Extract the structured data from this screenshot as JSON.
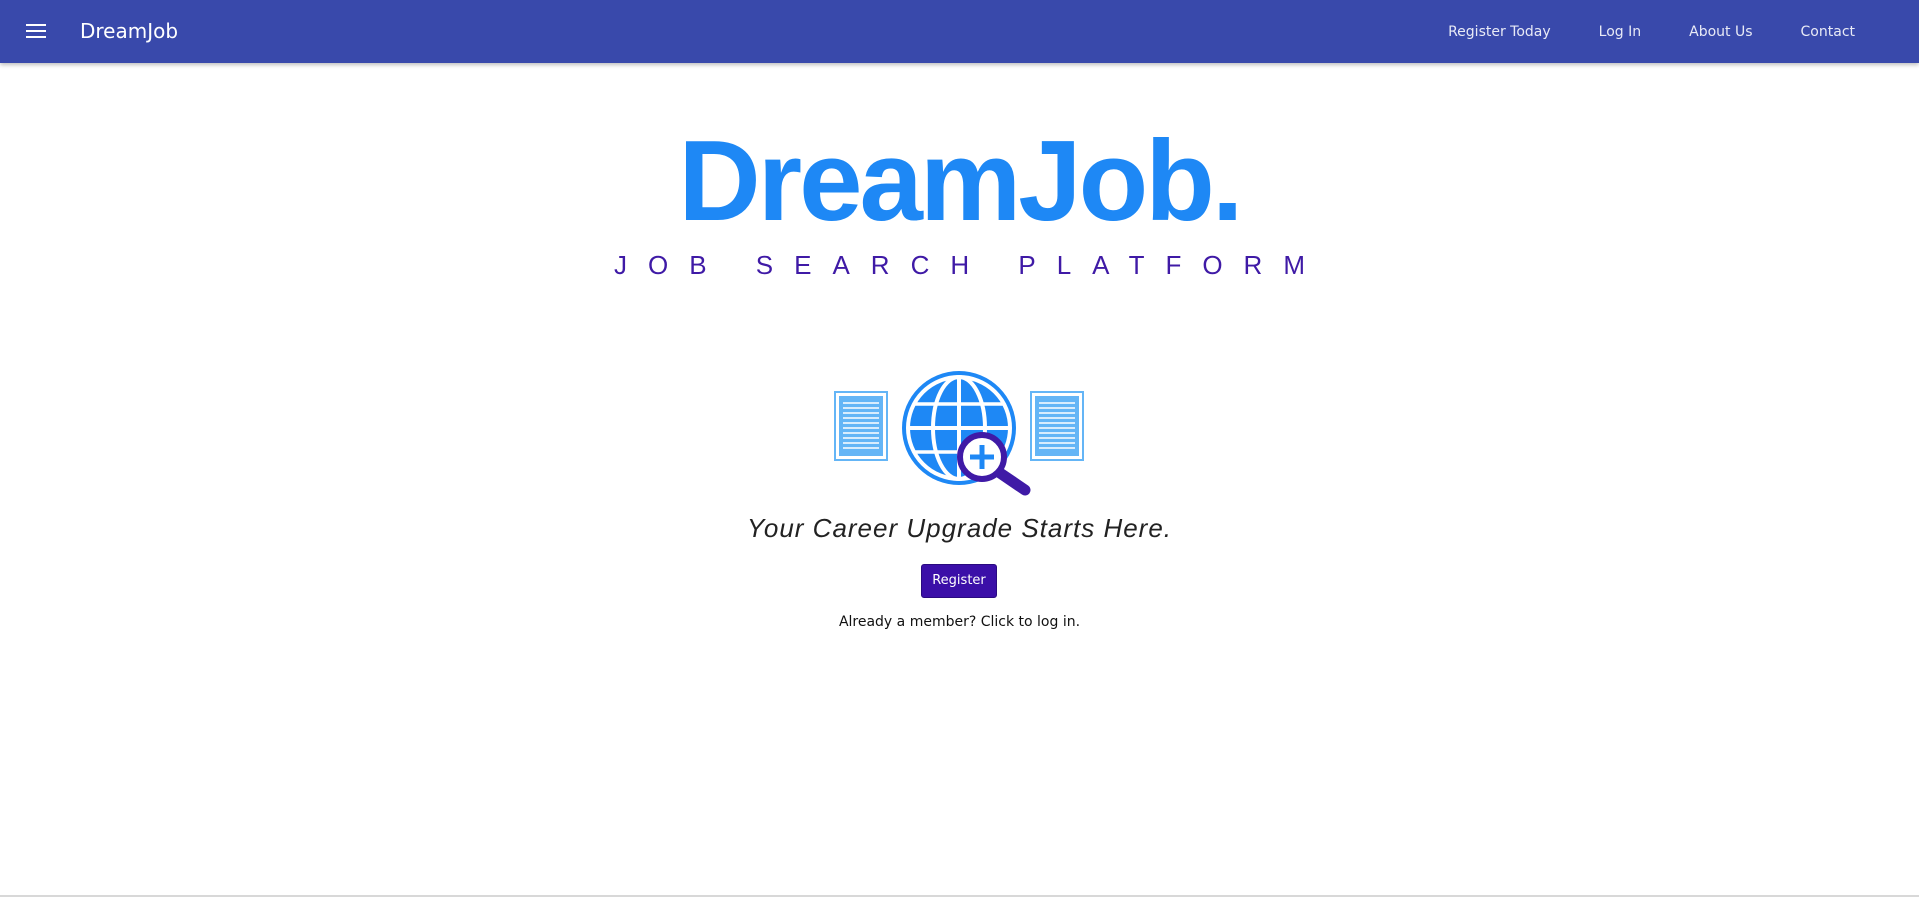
{
  "appbar": {
    "brand": "DreamJob",
    "menu_icon": "hamburger-menu-icon",
    "nav": [
      {
        "label": "Register Today"
      },
      {
        "label": "Log In"
      },
      {
        "label": "About Us"
      },
      {
        "label": "Contact"
      }
    ],
    "background": "#3949ab"
  },
  "hero": {
    "logo_wordmark": "DreamJob.",
    "logo_tagline": "JOB SEARCH PLATFORM",
    "logo_graphic_icons": [
      "document-icon",
      "globe-icon",
      "magnifier-icon",
      "document-icon"
    ],
    "slogan": "Your Career Upgrade Starts Here.",
    "register_button": "Register",
    "login_hint": "Already a member? Click to log in.",
    "colors": {
      "logo_blue": "#1e88f5",
      "tagline_purple": "#3f1aa6",
      "button": "#3b0fa8"
    }
  }
}
